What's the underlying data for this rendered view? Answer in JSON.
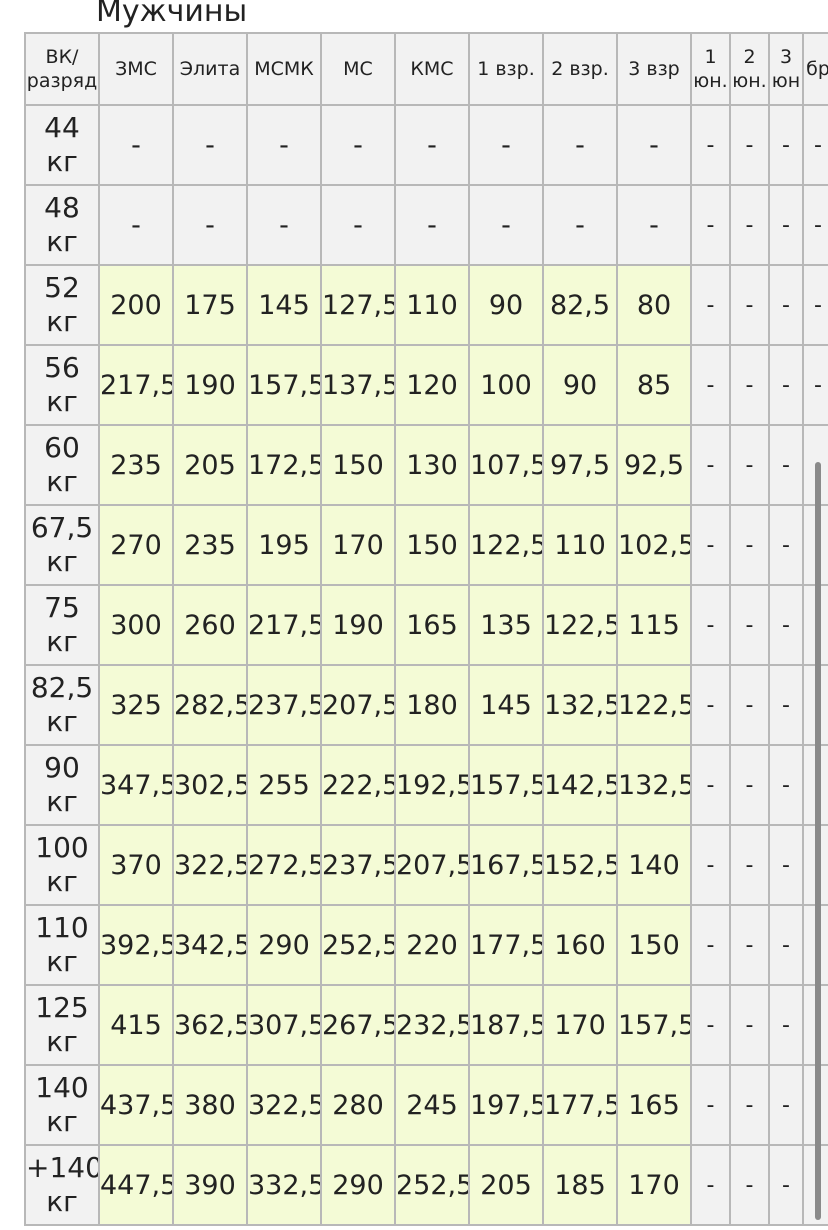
{
  "title": "Мужчины",
  "columns": [
    "ВК/ разряд",
    "ЗМС",
    "Элита",
    "МСМК",
    "МС",
    "КМС",
    "1 взр.",
    "2 взр.",
    "3 взр",
    "1 юн.",
    "2 юн.",
    "3 юн",
    "бр"
  ],
  "rows": [
    {
      "label": "44 кг",
      "cells": [
        "-",
        "-",
        "-",
        "-",
        "-",
        "-",
        "-",
        "-",
        "-",
        "-",
        "-",
        "-"
      ]
    },
    {
      "label": "48 кг",
      "cells": [
        "-",
        "-",
        "-",
        "-",
        "-",
        "-",
        "-",
        "-",
        "-",
        "-",
        "-",
        "-"
      ]
    },
    {
      "label": "52 кг",
      "cells": [
        "200",
        "175",
        "145",
        "127,5",
        "110",
        "90",
        "82,5",
        "80",
        "-",
        "-",
        "-",
        "-"
      ]
    },
    {
      "label": "56 кг",
      "cells": [
        "217,5",
        "190",
        "157,5",
        "137,5",
        "120",
        "100",
        "90",
        "85",
        "-",
        "-",
        "-",
        "-"
      ]
    },
    {
      "label": "60 кг",
      "cells": [
        "235",
        "205",
        "172,5",
        "150",
        "130",
        "107,5",
        "97,5",
        "92,5",
        "-",
        "-",
        "-",
        "-"
      ]
    },
    {
      "label": "67,5 кг",
      "cells": [
        "270",
        "235",
        "195",
        "170",
        "150",
        "122,5",
        "110",
        "102,5",
        "-",
        "-",
        "-",
        "-"
      ]
    },
    {
      "label": "75 кг",
      "cells": [
        "300",
        "260",
        "217,5",
        "190",
        "165",
        "135",
        "122,5",
        "115",
        "-",
        "-",
        "-",
        "-"
      ]
    },
    {
      "label": "82,5 кг",
      "cells": [
        "325",
        "282,5",
        "237,5",
        "207,5",
        "180",
        "145",
        "132,5",
        "122,5",
        "-",
        "-",
        "-",
        "-"
      ]
    },
    {
      "label": "90 кг",
      "cells": [
        "347,5",
        "302,5",
        "255",
        "222,5",
        "192,5",
        "157,5",
        "142,5",
        "132,5",
        "-",
        "-",
        "-",
        "-"
      ]
    },
    {
      "label": "100 кг",
      "cells": [
        "370",
        "322,5",
        "272,5",
        "237,5",
        "207,5",
        "167,5",
        "152,5",
        "140",
        "-",
        "-",
        "-",
        "-"
      ]
    },
    {
      "label": "110 кг",
      "cells": [
        "392,5",
        "342,5",
        "290",
        "252,5",
        "220",
        "177,5",
        "160",
        "150",
        "-",
        "-",
        "-",
        "-"
      ]
    },
    {
      "label": "125 кг",
      "cells": [
        "415",
        "362,5",
        "307,5",
        "267,5",
        "232,5",
        "187,5",
        "170",
        "157,5",
        "-",
        "-",
        "-",
        "-"
      ]
    },
    {
      "label": "140 кг",
      "cells": [
        "437,5",
        "380",
        "322,5",
        "280",
        "245",
        "197,5",
        "177,5",
        "165",
        "-",
        "-",
        "-",
        "-"
      ]
    },
    {
      "label": "+140 кг",
      "cells": [
        "447,5",
        "390",
        "332,5",
        "290",
        "252,5",
        "205",
        "185",
        "170",
        "-",
        "-",
        "-",
        "-"
      ]
    }
  ],
  "colors": {
    "value_bg": "#f4fbd6",
    "header_bg": "#f2f2f2",
    "grid": "#b8b8b8"
  }
}
